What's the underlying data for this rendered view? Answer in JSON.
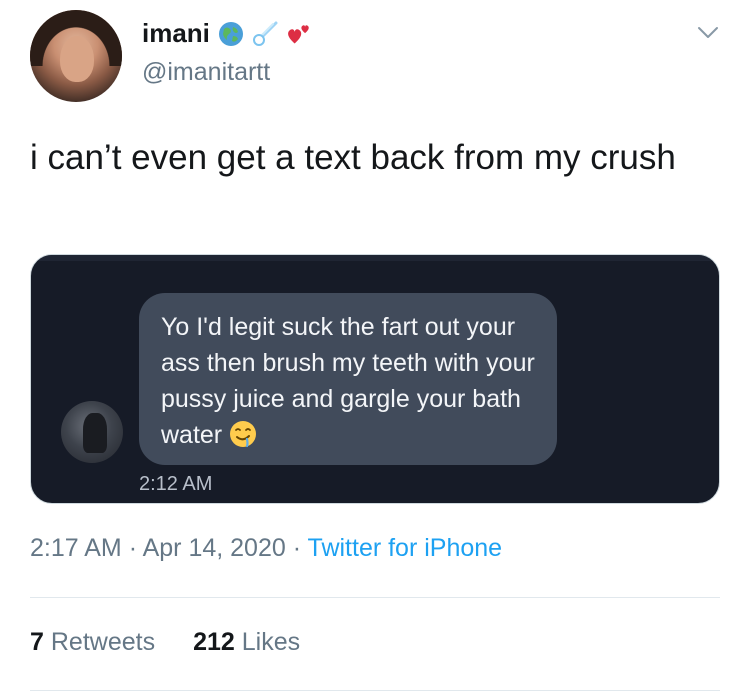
{
  "author": {
    "display_name": "imani",
    "handle": "@imanitartt",
    "name_emojis": [
      "globe-emoji",
      "comet-emoji",
      "heart-exclamation-emoji"
    ]
  },
  "tweet": {
    "text": "i can’t even get a text back from my crush"
  },
  "media": {
    "message_text": "Yo I'd legit suck the fart out your ass then brush my teeth with your pussy juice and gargle your bath water",
    "message_emoji": "drooling-face-emoji",
    "message_time": "2:12 AM"
  },
  "meta": {
    "time": "2:17 AM",
    "date": "Apr 14, 2020",
    "separator": "·",
    "source": "Twitter for iPhone"
  },
  "stats": {
    "retweets_count": "7",
    "retweets_label": "Retweets",
    "likes_count": "212",
    "likes_label": "Likes"
  },
  "colors": {
    "link_blue": "#1da1f2",
    "muted_gray": "#657786",
    "media_bg": "#161b27",
    "bubble_bg": "#414b5b"
  }
}
